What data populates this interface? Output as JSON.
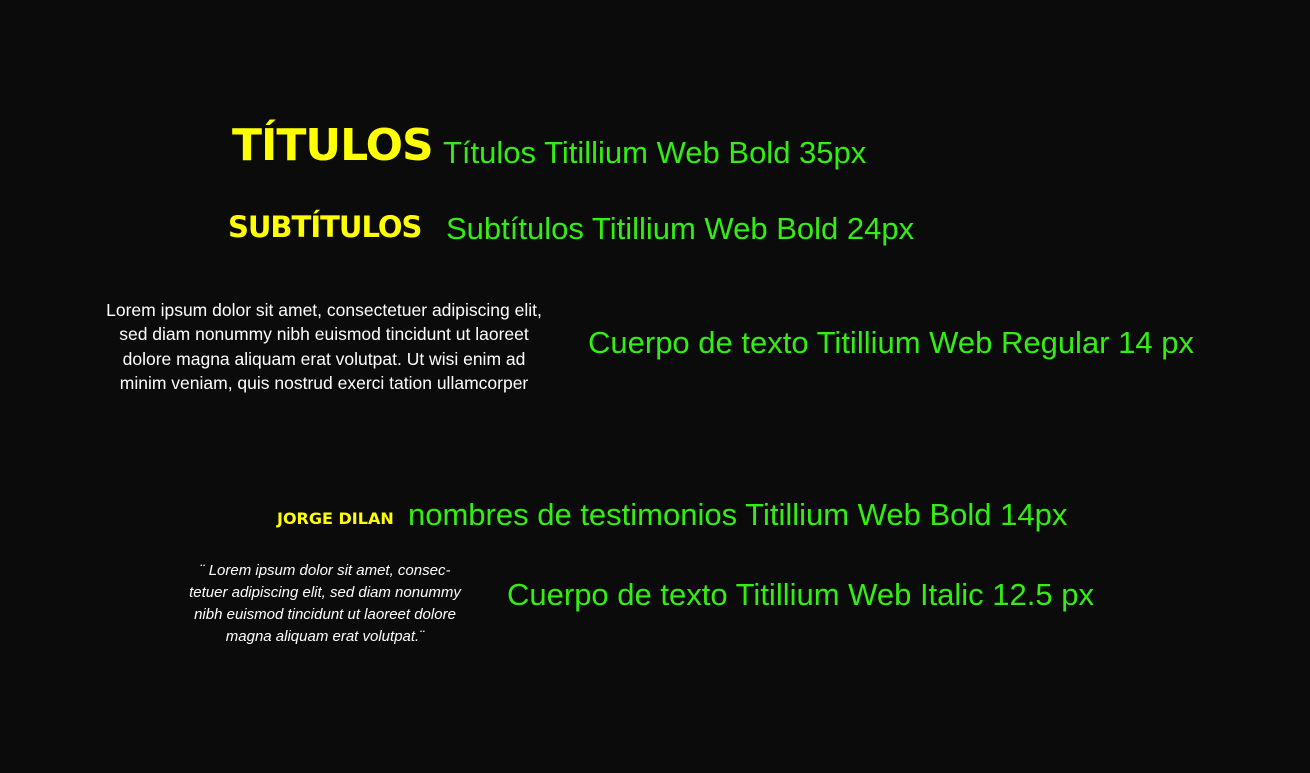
{
  "colors": {
    "background": "#0b0b0c",
    "sample_accent": "#ffff00",
    "description": "#33ee11",
    "body_sample": "#ffffff"
  },
  "rows": {
    "title": {
      "sample": "TÍTULOS",
      "description": "Títulos Titillium Web Bold 35px"
    },
    "subtitle": {
      "sample": "SUBTÍTULOS",
      "description": "Subtítulos Titillium Web Bold 24px"
    },
    "body": {
      "sample_lines": [
        "Lorem ipsum dolor sit amet, consectetuer adipiscing elit,",
        "sed diam nonummy nibh euismod tincidunt ut laoreet",
        "dolore magna aliquam erat volutpat. Ut wisi enim ad",
        "minim veniam, quis nostrud exerci tation ullamcorper"
      ],
      "description": "Cuerpo de texto Titillium Web Regular 14 px"
    },
    "testimonial_name": {
      "sample": "JORGE DILAN",
      "description": "nombres de testimonios Titillium Web Bold 14px"
    },
    "testimonial_quote": {
      "sample_lines": [
        "¨ Lorem ipsum dolor sit amet, consec-",
        "tetuer adipiscing elit, sed diam nonummy",
        "nibh euismod tincidunt ut laoreet dolore",
        "magna aliquam erat volutpat.¨"
      ],
      "description": "Cuerpo de texto Titillium Web Italic 12.5 px"
    }
  }
}
